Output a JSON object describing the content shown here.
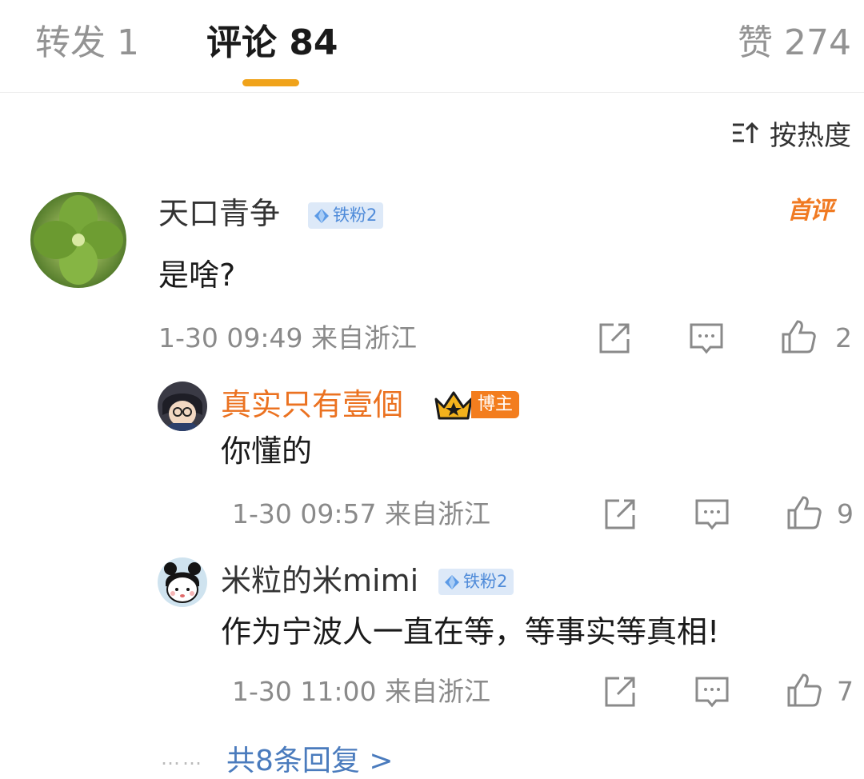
{
  "tabs": {
    "repost": "转发 1",
    "comments": "评论 84",
    "likes": "赞 274"
  },
  "sort": {
    "label": "按热度",
    "icon": "sort-icon"
  },
  "comment": {
    "username": "天口青争",
    "fan_badge": "铁粉2",
    "first_badge": "首评",
    "text": "是啥?",
    "meta": "1-30 09:49 来自浙江",
    "like_count": "2"
  },
  "replies": [
    {
      "username": "真实只有壹個",
      "role_badge": "博主",
      "text": "你懂的",
      "meta": "1-30 09:57 来自浙江",
      "like_count": "9"
    },
    {
      "username": "米粒的米mimi",
      "fan_badge": "铁粉2",
      "text": "作为宁波人一直在等，等事实等真相!",
      "meta": "1-30 11:00 来自浙江",
      "like_count": "7"
    }
  ],
  "more_replies": {
    "dots": "……",
    "label": "共8条回复 >"
  },
  "colors": {
    "accent_underline": "#f0a31b",
    "blogger_name": "#eb7221",
    "link": "#4a7bbd",
    "fan_badge_bg": "#dde9f8"
  }
}
